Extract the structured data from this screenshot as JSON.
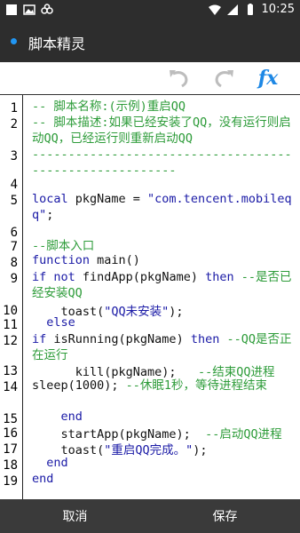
{
  "status": {
    "time": "10:25"
  },
  "app": {
    "title": "脚本精灵"
  },
  "toolbar": {
    "fx_label": "fx"
  },
  "gutter": [
    "1",
    "2",
    "3",
    "4",
    "5",
    "6",
    "7",
    "8",
    "9",
    "10",
    "11",
    "12",
    "13",
    "14",
    "15",
    "16",
    "17",
    "18",
    "19"
  ],
  "code": [
    {
      "id": "l1",
      "segs": [
        {
          "t": "-- 脚本名称:(示例)重启QQ",
          "c": "cmt"
        }
      ]
    },
    {
      "id": "l2",
      "segs": [
        {
          "t": "-- 脚本描述:如果已经安装了QQ，没有运行则启动QQ，已经运行则重新启动QQ",
          "c": "cmt"
        }
      ]
    },
    {
      "id": "l3",
      "segs": [
        {
          "t": "--------------------------------------------------------",
          "c": "cmt"
        }
      ]
    },
    {
      "id": "l5",
      "segs": [
        {
          "t": "local",
          "c": "kw"
        },
        {
          "t": " pkgName = ",
          "c": "fn"
        },
        {
          "t": "\"com.tencent.mobileqq\"",
          "c": "str"
        },
        {
          "t": ";",
          "c": "fn"
        }
      ]
    },
    {
      "id": "l7",
      "segs": [
        {
          "t": "--脚本入口",
          "c": "cmt"
        }
      ]
    },
    {
      "id": "l8",
      "segs": [
        {
          "t": "function",
          "c": "kw"
        },
        {
          "t": " main()",
          "c": "fn"
        }
      ]
    },
    {
      "id": "l9",
      "segs": [
        {
          "t": "  if not",
          "c": "kw"
        },
        {
          "t": " findApp(pkgName) ",
          "c": "fn"
        },
        {
          "t": "then",
          "c": "kw"
        },
        {
          "t": " --是否已经安装QQ",
          "c": "cmt"
        }
      ]
    },
    {
      "id": "l10",
      "segs": [
        {
          "t": "    toast(",
          "c": "fn"
        },
        {
          "t": "\"QQ未安装\"",
          "c": "str"
        },
        {
          "t": ");",
          "c": "fn"
        }
      ]
    },
    {
      "id": "l11",
      "segs": [
        {
          "t": "  else",
          "c": "kw"
        }
      ]
    },
    {
      "id": "l12",
      "segs": [
        {
          "t": "    if",
          "c": "kw"
        },
        {
          "t": " isRunning(pkgName) ",
          "c": "fn"
        },
        {
          "t": "then",
          "c": "kw"
        },
        {
          "t": " --QQ是否正在运行",
          "c": "cmt"
        }
      ]
    },
    {
      "id": "l13",
      "segs": [
        {
          "t": "      kill(pkgName);   ",
          "c": "fn"
        },
        {
          "t": "--结束QQ进程",
          "c": "cmt"
        }
      ]
    },
    {
      "id": "l14",
      "segs": [
        {
          "t": "      sleep(1000); ",
          "c": "fn"
        },
        {
          "t": "--休眠1秒，等待进程结束",
          "c": "cmt"
        }
      ]
    },
    {
      "id": "l15",
      "segs": [
        {
          "t": "    end",
          "c": "kw"
        }
      ]
    },
    {
      "id": "l16",
      "segs": [
        {
          "t": "    startApp(pkgName);  ",
          "c": "fn"
        },
        {
          "t": "--启动QQ进程",
          "c": "cmt"
        }
      ]
    },
    {
      "id": "l17",
      "segs": [
        {
          "t": "    toast(",
          "c": "fn"
        },
        {
          "t": "\"重启QQ完成。\"",
          "c": "str"
        },
        {
          "t": ");",
          "c": "fn"
        }
      ]
    },
    {
      "id": "l18",
      "segs": [
        {
          "t": "  end",
          "c": "kw"
        }
      ]
    },
    {
      "id": "l19",
      "segs": [
        {
          "t": "end",
          "c": "kw"
        }
      ]
    }
  ],
  "bottom": {
    "cancel": "取消",
    "save": "保存"
  }
}
